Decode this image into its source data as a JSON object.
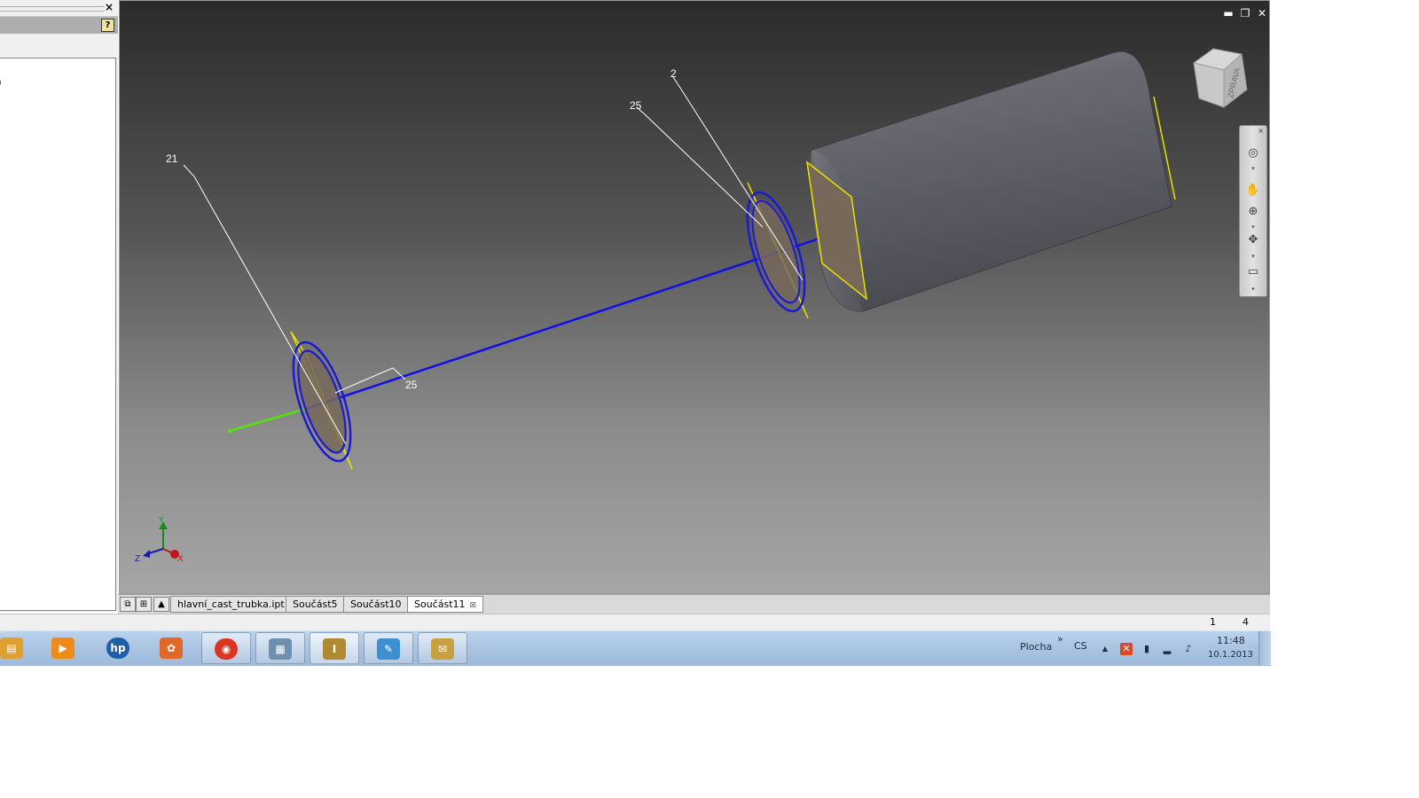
{
  "left_panel": {
    "close_glyph": "×",
    "help_glyph": "?",
    "tree_partial_text": ")"
  },
  "window_controls": {
    "minimize_glyph": "▬",
    "restore_glyph": "❐",
    "close_glyph": "✕"
  },
  "viewport": {
    "background_top": "#2b2b2b",
    "background_bottom": "#a6a6a6",
    "dimension_labels": {
      "left_leader": "21",
      "left_dimension": "25",
      "right_leader_top": "2",
      "right_leader_second": "25"
    },
    "viewcube_face_label": "ZPRAVA",
    "triad_labels": {
      "y": "Y",
      "z": "Z",
      "x": "X"
    },
    "colors": {
      "axis_line": "#1010e6",
      "circle": "#1a1ad2",
      "plane_outline": "#e8e000",
      "green_axis": "#55e010",
      "leader_line": "#ffffff",
      "solid_body": "#5c5c62"
    }
  },
  "navbar": {
    "close_glyph": "×",
    "items": [
      {
        "name": "steering-wheel",
        "glyph": "◎"
      },
      {
        "name": "pan",
        "glyph": "✋"
      },
      {
        "name": "zoom",
        "glyph": "⊕"
      },
      {
        "name": "orbit",
        "glyph": "✥"
      },
      {
        "name": "look-at",
        "glyph": "▭"
      }
    ],
    "arrow_glyph": "▾"
  },
  "tabbar": {
    "icons": [
      "⧉",
      "⊞",
      "▲"
    ],
    "tabs": [
      {
        "label": "hlavní_cast_trubka.ipt",
        "active": false
      },
      {
        "label": "Součást5",
        "active": false
      },
      {
        "label": "Součást10",
        "active": false
      },
      {
        "label": "Součást11",
        "active": true,
        "close_glyph": "⊠"
      }
    ]
  },
  "statusbar": {
    "value_1": "1",
    "value_2": "4"
  },
  "taskbar": {
    "apps": [
      {
        "name": "explorer",
        "glyph": "▤",
        "color": "#e0a030"
      },
      {
        "name": "media-player",
        "glyph": "▶",
        "color": "#f08a1a"
      },
      {
        "name": "hp",
        "glyph": "hp",
        "color": "#1f5fa8"
      },
      {
        "name": "photo-app",
        "glyph": "✿",
        "color": "#e2682a"
      },
      {
        "name": "chrome",
        "glyph": "◉",
        "color": "#dd3322"
      },
      {
        "name": "calculator",
        "glyph": "▦",
        "color": "#6f8fb0"
      },
      {
        "name": "inventor-pro",
        "glyph": "I",
        "color": "#b08a30"
      },
      {
        "name": "paint",
        "glyph": "✎",
        "color": "#3c8fd0"
      },
      {
        "name": "app-window",
        "glyph": "✉",
        "color": "#c9a040"
      }
    ],
    "desktop_label": "Plocha",
    "desktop_chevron": "»",
    "language": "CS",
    "tray_expand": "▲",
    "time": "11:48",
    "date": "10.1.2013"
  }
}
